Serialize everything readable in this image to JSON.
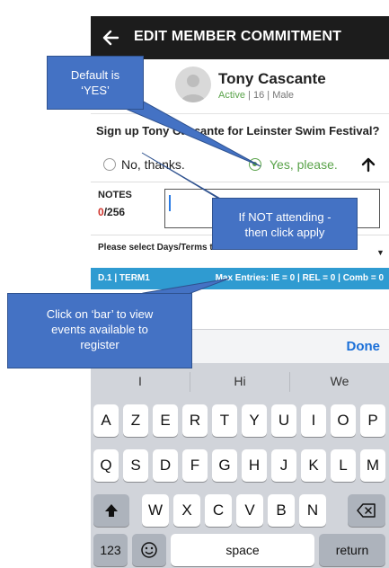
{
  "header": {
    "title": "EDIT MEMBER COMMITMENT",
    "back_icon": "back-arrow-icon"
  },
  "member": {
    "name": "Tony Cascante",
    "status": "Active",
    "age": "16",
    "gender": "Male",
    "sep": "|"
  },
  "question": "Sign up Tony Cascante for Leinster Swim Festival?",
  "options": {
    "no": "No, thanks.",
    "yes": "Yes, please.",
    "selected": "yes"
  },
  "notes": {
    "label": "NOTES",
    "count": "0",
    "max": "/256"
  },
  "days": {
    "label": "Please select Days/Terms t"
  },
  "term_bar": {
    "left": "D.1 | TERM1",
    "right": "Max Entries: IE = 0 | REL = 0 | Comb = 0"
  },
  "keyboard": {
    "done": "Done",
    "predictions": [
      "I",
      "Hi",
      "We"
    ],
    "row1": [
      "A",
      "Z",
      "E",
      "R",
      "T",
      "Y",
      "U",
      "I",
      "O",
      "P"
    ],
    "row2": [
      "Q",
      "S",
      "D",
      "F",
      "G",
      "H",
      "J",
      "K",
      "L",
      "M"
    ],
    "row3": [
      "W",
      "X",
      "C",
      "V",
      "B",
      "N"
    ],
    "numbers": "123",
    "space": "space",
    "return": "return"
  },
  "annotations": {
    "default": "Default is\n‘YES’",
    "not_attending": "If NOT attending -\nthen click apply",
    "bar": "Click on ‘bar’ to view\nevents available to\nregister"
  },
  "colors": {
    "accent_green": "#5aa34a",
    "term_bar": "#2f9bd1",
    "callout": "#4472c4",
    "link_blue": "#1a6fd8",
    "counter_red": "#d0342c"
  }
}
